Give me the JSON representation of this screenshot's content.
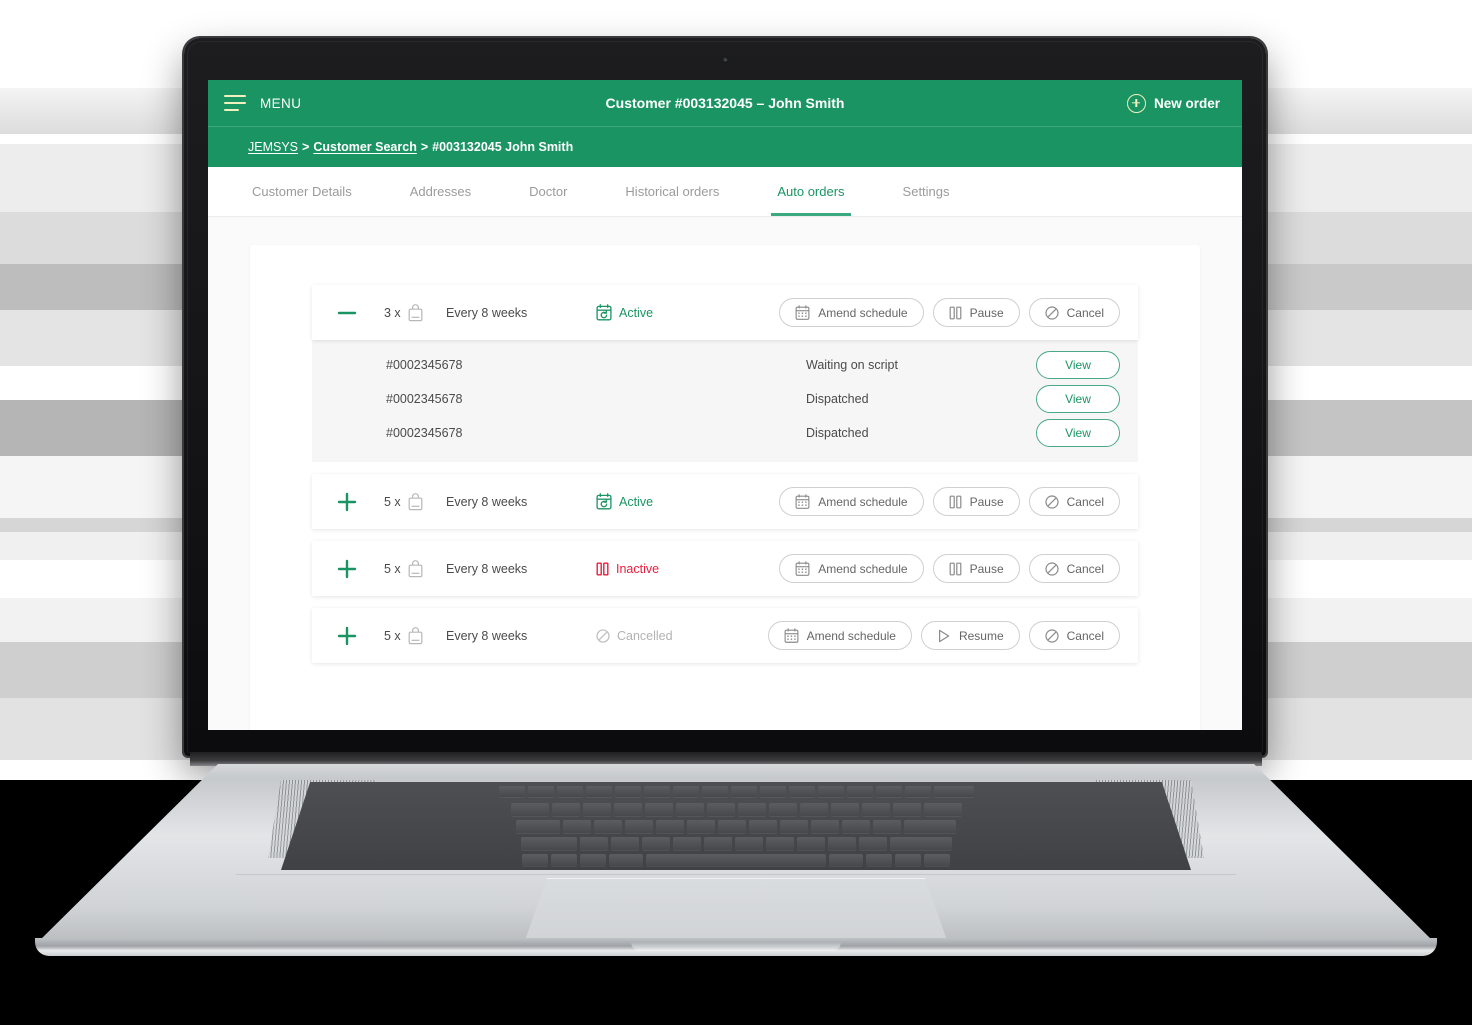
{
  "colors": {
    "brand_green": "#1b9464",
    "accent_cream": "#f2f0bf",
    "status_active": "#1b9464",
    "status_inactive": "#ec1c3c",
    "status_cancelled": "#b3b3b3",
    "page_bg": "#fafafa",
    "subpanel_bg": "#f6f6f6"
  },
  "topbar": {
    "menu_label": "MENU",
    "title": "Customer #003132045 – John Smith",
    "new_order_label": "New order"
  },
  "breadcrumb": {
    "root": "JEMSYS",
    "sep1": ">",
    "parent": "Customer Search",
    "sep2": ">",
    "current": "#003132045 John Smith"
  },
  "tabs": [
    {
      "label": "Customer Details",
      "active": false
    },
    {
      "label": "Addresses",
      "active": false
    },
    {
      "label": "Doctor",
      "active": false
    },
    {
      "label": "Historical orders",
      "active": false
    },
    {
      "label": "Auto orders",
      "active": true
    },
    {
      "label": "Settings",
      "active": false
    }
  ],
  "orders": [
    {
      "expanded": true,
      "toggle_icon": "minus-icon",
      "quantity": "3 x",
      "product_icon": "shopping-bag-icon",
      "frequency": "Every 8 weeks",
      "status": {
        "label": "Active",
        "state": "active",
        "icon": "calendar-recurring-icon"
      },
      "buttons": [
        {
          "label": "Amend schedule",
          "icon": "calendar-icon"
        },
        {
          "label": "Pause",
          "icon": "pause-icon"
        },
        {
          "label": "Cancel",
          "icon": "prohibition-icon"
        }
      ],
      "suborders": [
        {
          "order_id": "#0002345678",
          "status": "Waiting on script",
          "view_label": "View"
        },
        {
          "order_id": "#0002345678",
          "status": "Dispatched",
          "view_label": "View"
        },
        {
          "order_id": "#0002345678",
          "status": "Dispatched",
          "view_label": "View"
        }
      ]
    },
    {
      "expanded": false,
      "toggle_icon": "plus-icon",
      "quantity": "5 x",
      "product_icon": "shopping-bag-icon",
      "frequency": "Every 8 weeks",
      "status": {
        "label": "Active",
        "state": "active",
        "icon": "calendar-recurring-icon"
      },
      "buttons": [
        {
          "label": "Amend schedule",
          "icon": "calendar-icon"
        },
        {
          "label": "Pause",
          "icon": "pause-icon"
        },
        {
          "label": "Cancel",
          "icon": "prohibition-icon"
        }
      ],
      "suborders": []
    },
    {
      "expanded": false,
      "toggle_icon": "plus-icon",
      "quantity": "5 x",
      "product_icon": "shopping-bag-icon",
      "frequency": "Every 8 weeks",
      "status": {
        "label": "Inactive",
        "state": "inactive",
        "icon": "pause-icon"
      },
      "buttons": [
        {
          "label": "Amend schedule",
          "icon": "calendar-icon"
        },
        {
          "label": "Pause",
          "icon": "pause-icon"
        },
        {
          "label": "Cancel",
          "icon": "prohibition-icon"
        }
      ],
      "suborders": []
    },
    {
      "expanded": false,
      "toggle_icon": "plus-icon",
      "quantity": "5 x",
      "product_icon": "shopping-bag-icon",
      "frequency": "Every 8 weeks",
      "status": {
        "label": "Cancelled",
        "state": "cancelled",
        "icon": "prohibition-icon"
      },
      "buttons": [
        {
          "label": "Amend schedule",
          "icon": "calendar-icon"
        },
        {
          "label": "Resume",
          "icon": "play-icon"
        },
        {
          "label": "Cancel",
          "icon": "prohibition-icon"
        }
      ],
      "suborders": []
    }
  ]
}
